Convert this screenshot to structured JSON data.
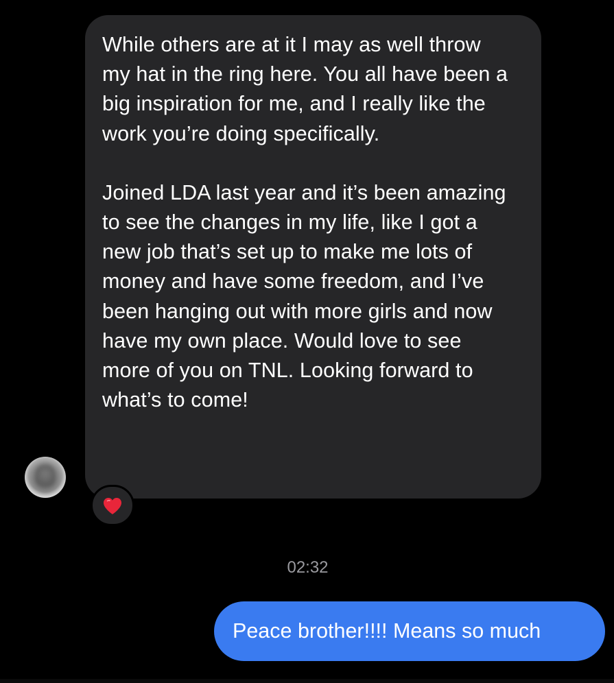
{
  "thread": {
    "incoming_message": {
      "paragraphs": [
        "While others are at it I may as well throw my hat in the ring here. You all have been a big inspiration for me, and I really like the work you’re doing specifically.",
        "Joined LDA last year and it’s been amazing to see the changes in my life, like I got a new job that’s set up to make me lots of money and have some freedom, and I’ve been hanging out with more girls and now have my own place. Would love to see more of you on TNL. Looking forward to what’s to come!"
      ],
      "reaction_icon": "red-heart-icon",
      "avatar_icon": "blurred-profile-avatar"
    },
    "timestamp": "02:32",
    "outgoing_message": {
      "text": "Peace brother!!!! Means so much"
    }
  },
  "colors": {
    "background": "#000000",
    "incoming_bubble": "#262628",
    "outgoing_bubble": "#3a7bf0",
    "timestamp_text": "#9a9a9f",
    "heart": "#e8263a"
  }
}
